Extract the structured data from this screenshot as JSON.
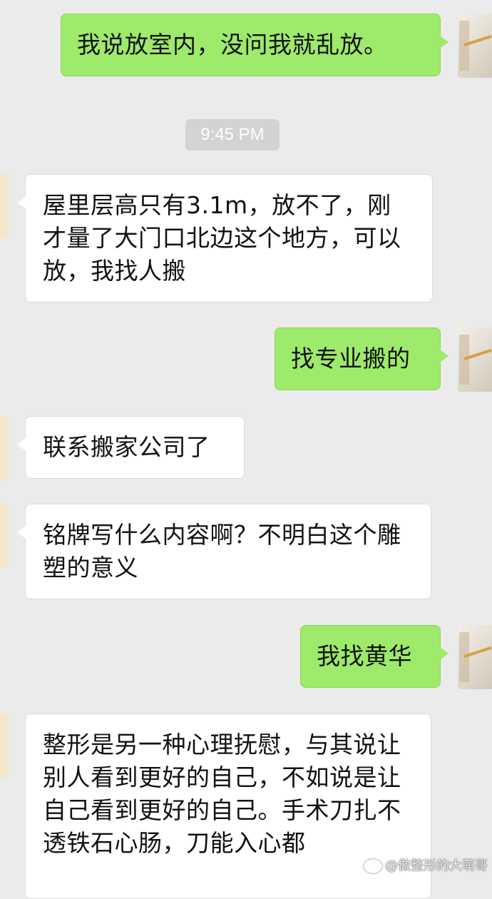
{
  "conversation": {
    "messages": [
      {
        "side": "outgoing",
        "text": "我说放室内，没问我就乱放。"
      },
      {
        "side": "incoming",
        "text": "屋里层高只有3.1m，放不了，刚才量了大门口北边这个地方，可以放，我找人搬"
      },
      {
        "side": "outgoing",
        "text": "找专业搬的"
      },
      {
        "side": "incoming",
        "text": "联系搬家公司了"
      },
      {
        "side": "incoming",
        "text": "铭牌写什么内容啊？不明白这个雕塑的意义"
      },
      {
        "side": "outgoing",
        "text": "我找黄华"
      },
      {
        "side": "incoming",
        "text": "整形是另一种心理抚慰，与其说让别人看到更好的自己，不如说是让自己看到更好的自己。手术刀扎不透铁石心肠，刀能入心都"
      }
    ],
    "timestamp": "9:45 PM"
  },
  "watermark": {
    "text": "@做整形的大萌哥",
    "icon": "weibo-icon"
  },
  "colors": {
    "background": "#ebebeb",
    "outgoing_bubble": "#9eea6a",
    "incoming_bubble": "#ffffff",
    "time_chip": "#d3d3d3"
  }
}
